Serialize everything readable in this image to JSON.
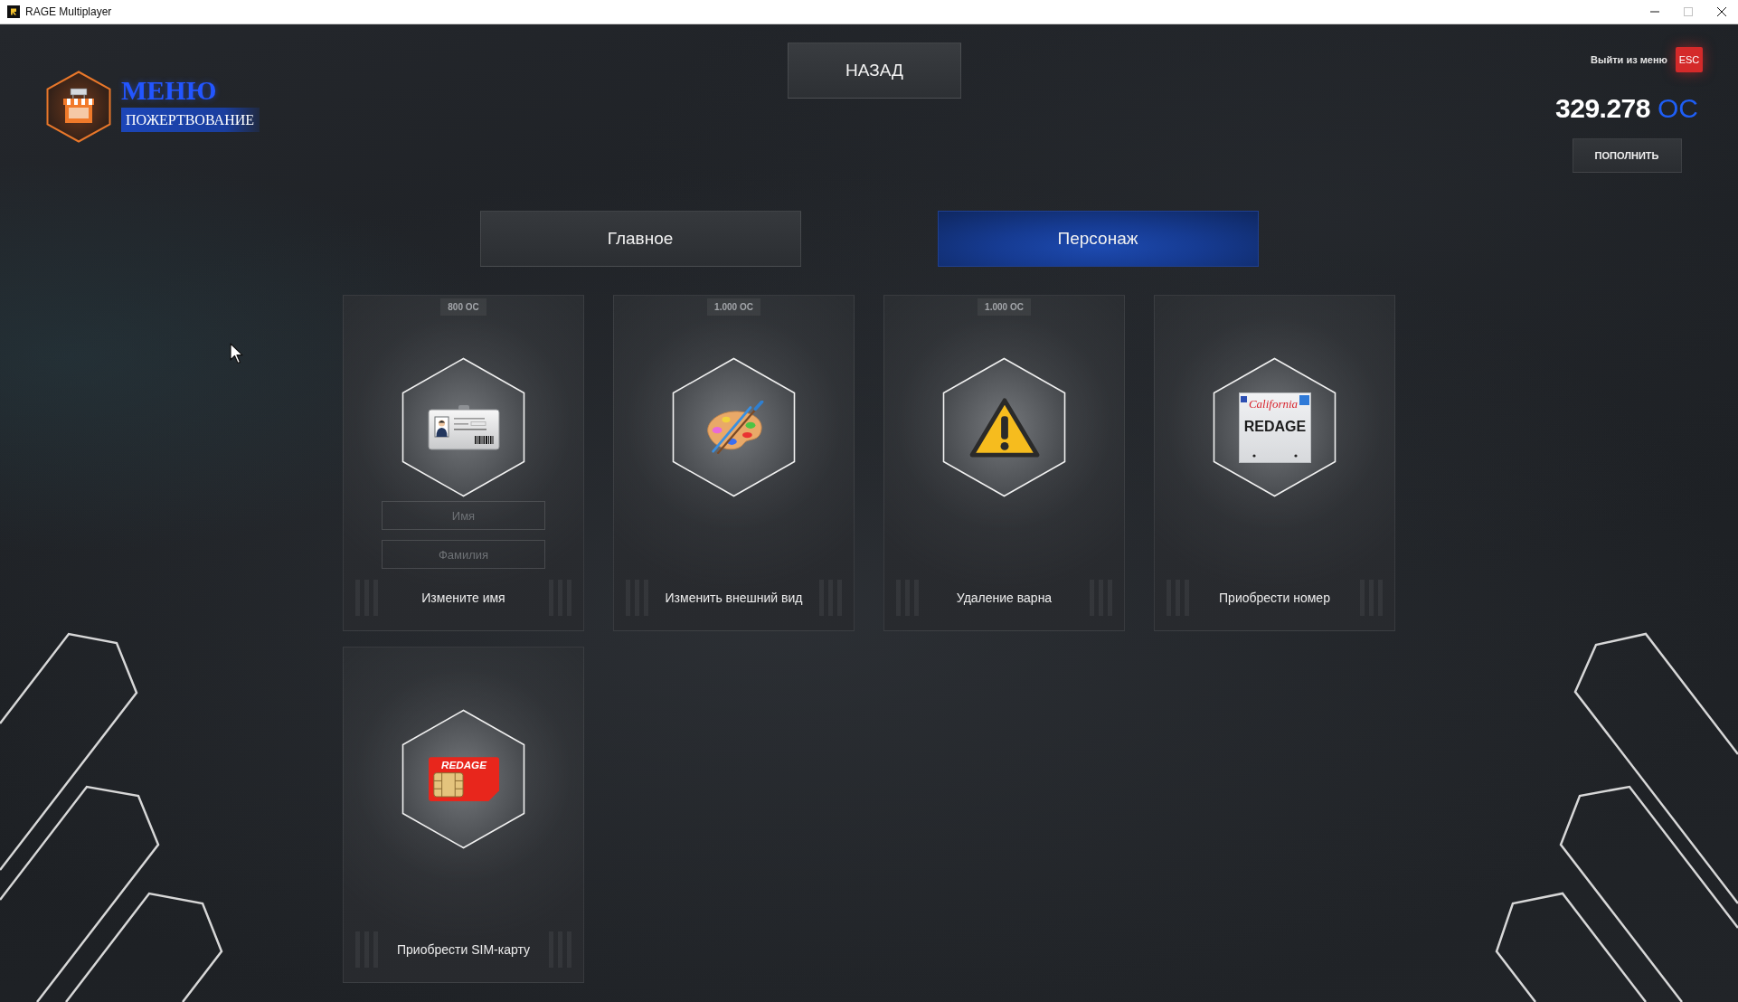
{
  "window": {
    "title": "RAGE Multiplayer",
    "controls": [
      {
        "kind": "minimize",
        "disabled": false
      },
      {
        "kind": "maximize",
        "disabled": true
      },
      {
        "kind": "close",
        "disabled": false
      }
    ]
  },
  "header": {
    "title": "МЕНЮ",
    "subtitle": "ПОЖЕРТВОВАНИЕ",
    "back_button": "НАЗАД",
    "exit": {
      "label": "Выйти из меню",
      "key": "ESC"
    },
    "balance": {
      "amount": "329.278",
      "currency": "OC"
    },
    "top_up_button": "ПОПОЛНИТЬ"
  },
  "tabs": [
    {
      "label": "Главное",
      "selected": false
    },
    {
      "label": "Персонаж",
      "selected": true
    }
  ],
  "items": [
    {
      "kind": "rename",
      "price": "800 OC",
      "title": "Измените имя",
      "fields": [
        {
          "placeholder": "Имя"
        },
        {
          "placeholder": "Фамилия"
        }
      ]
    },
    {
      "kind": "palette",
      "price": "1.000 OC",
      "title": "Изменить внешний вид"
    },
    {
      "kind": "warning",
      "price": "1.000 OC",
      "title": "Удаление варна"
    },
    {
      "kind": "plate",
      "title": "Приобрести номер",
      "plate": {
        "state": "California",
        "number": "REDAGE"
      }
    },
    {
      "kind": "sim",
      "title": "Приобрести SIM-карту",
      "sim": {
        "brand": "REDAGE"
      }
    }
  ]
}
